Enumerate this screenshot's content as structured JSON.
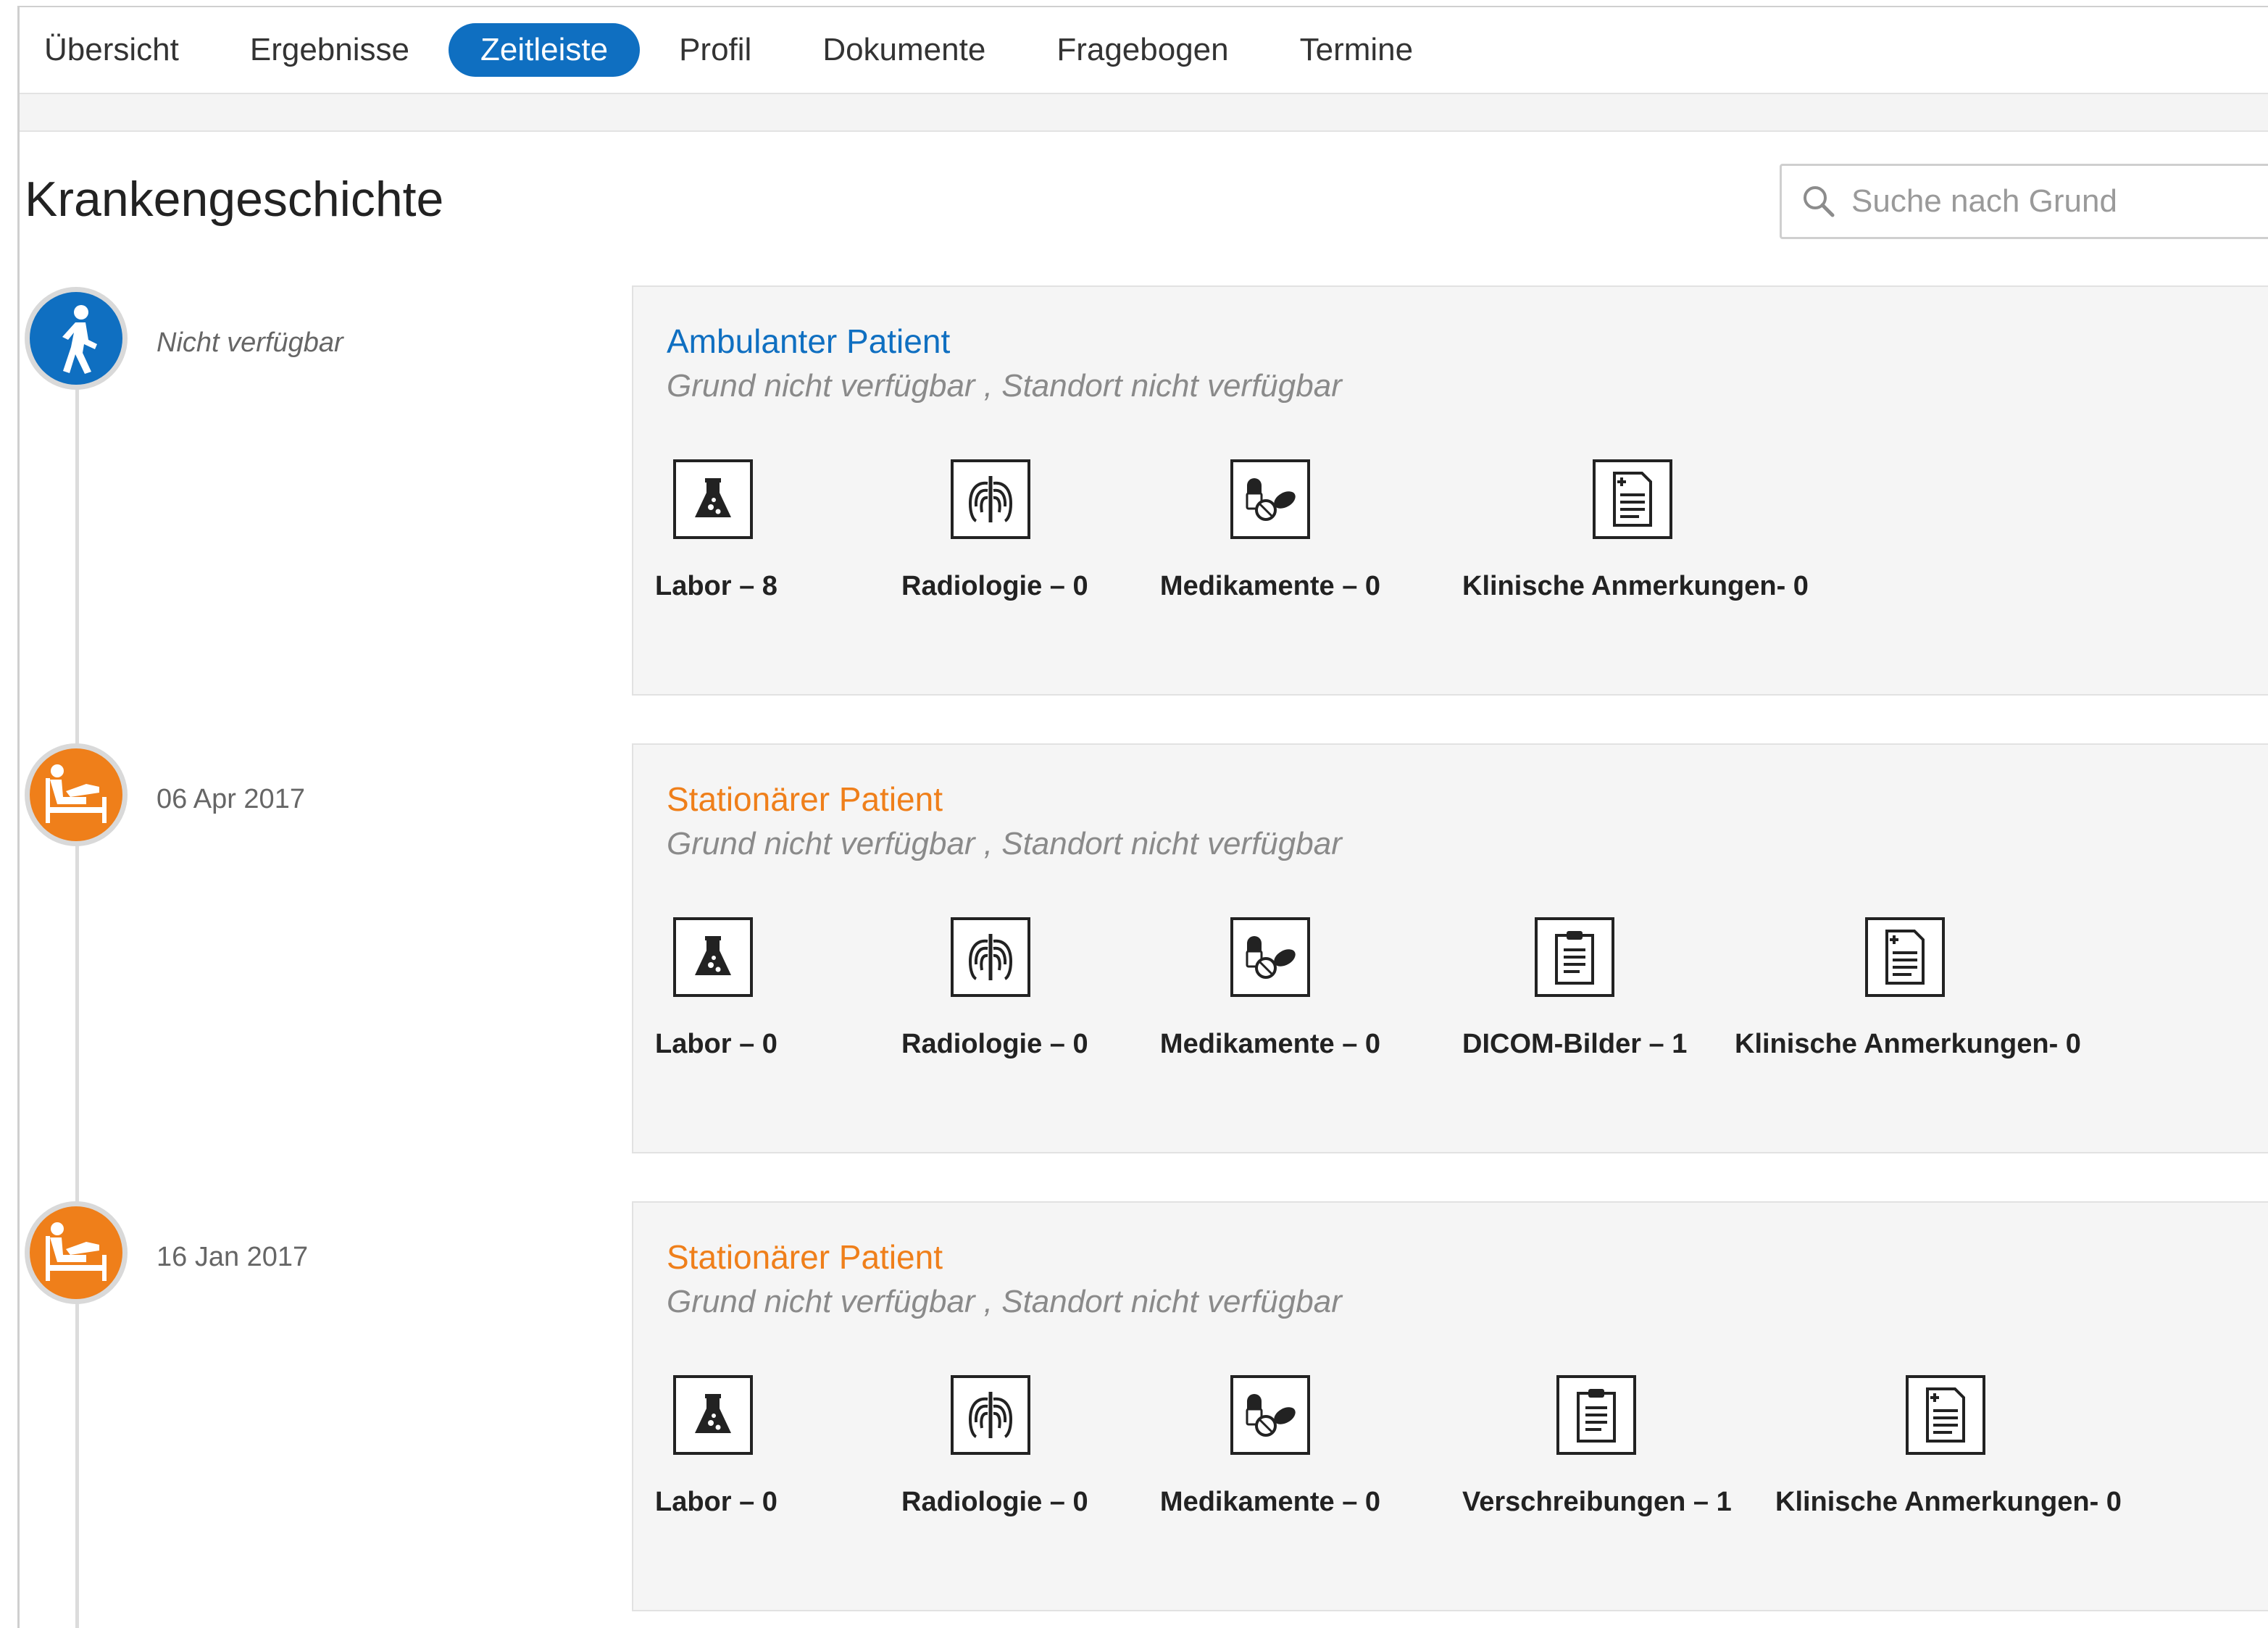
{
  "nav": {
    "items": [
      {
        "label": "Übersicht",
        "active": false
      },
      {
        "label": "Ergebnisse",
        "active": false
      },
      {
        "label": "Zeitleiste",
        "active": true
      },
      {
        "label": "Profil",
        "active": false
      },
      {
        "label": "Dokumente",
        "active": false
      },
      {
        "label": "Fragebogen",
        "active": false
      },
      {
        "label": "Termine",
        "active": false
      }
    ]
  },
  "page": {
    "title": "Krankengeschichte"
  },
  "search": {
    "placeholder": "Suche nach Grund",
    "value": ""
  },
  "colors": {
    "primary": "#0f6fc1",
    "accent": "#ef7f1a",
    "card_bg": "#f5f5f5"
  },
  "timeline": [
    {
      "date": "Nicht verfügbar",
      "icon": "walking-person-icon",
      "type": "Ambulanter Patient",
      "details": "Grund nicht verfügbar , Standort nicht verfügbar",
      "categories": [
        {
          "icon": "lab-flask-icon",
          "label": "Labor – 8"
        },
        {
          "icon": "radiology-ribcage-icon",
          "label": "Radiologie – 0"
        },
        {
          "icon": "medication-pills-icon",
          "label": "Medikamente – 0"
        },
        {
          "icon": "clinical-notes-icon",
          "label": "Klinische Anmerkungen- 0"
        }
      ]
    },
    {
      "date": "06 Apr 2017",
      "icon": "hospital-bed-icon",
      "type": "Stationärer Patient",
      "details": "Grund nicht verfügbar , Standort nicht verfügbar",
      "categories": [
        {
          "icon": "lab-flask-icon",
          "label": "Labor – 0"
        },
        {
          "icon": "radiology-ribcage-icon",
          "label": "Radiologie – 0"
        },
        {
          "icon": "medication-pills-icon",
          "label": "Medikamente – 0"
        },
        {
          "icon": "clipboard-icon",
          "label": "DICOM-Bilder – 1"
        },
        {
          "icon": "clinical-notes-icon",
          "label": "Klinische Anmerkungen- 0"
        }
      ]
    },
    {
      "date": "16 Jan 2017",
      "icon": "hospital-bed-icon",
      "type": "Stationärer Patient",
      "details": "Grund nicht verfügbar , Standort nicht verfügbar",
      "categories": [
        {
          "icon": "lab-flask-icon",
          "label": "Labor – 0"
        },
        {
          "icon": "radiology-ribcage-icon",
          "label": "Radiologie – 0"
        },
        {
          "icon": "medication-pills-icon",
          "label": "Medikamente – 0"
        },
        {
          "icon": "clipboard-icon",
          "label": "Verschreibungen – 1"
        },
        {
          "icon": "clinical-notes-icon",
          "label": "Klinische Anmerkungen- 0"
        }
      ]
    }
  ]
}
